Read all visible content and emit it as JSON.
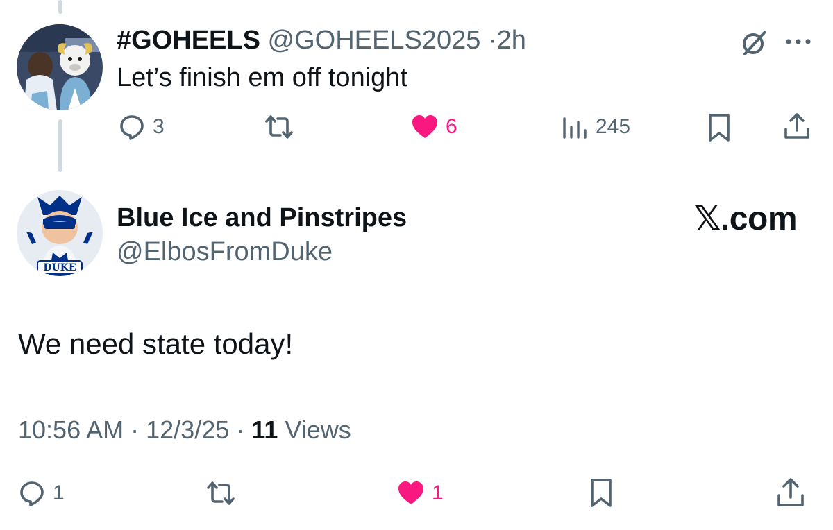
{
  "reply_tweet": {
    "display_name": "#GOHEELS",
    "handle": "@GOHEELS2025",
    "separator": "·",
    "time": "2h",
    "text": "Let’s finish em off tonight",
    "actions": {
      "replies": "3",
      "retweets": "",
      "likes": "6",
      "views": "245"
    },
    "avatar_icon": "unc-mascot-avatar",
    "grok_icon": "grok-icon",
    "more_icon": "more-options-icon"
  },
  "main_tweet": {
    "display_name": "Blue Ice and Pinstripes",
    "handle": "@ElbosFromDuke",
    "brand": "𝕏.com",
    "text": "We need state today!",
    "time": "10:56 AM",
    "date": "12/3/25",
    "separator": "·",
    "views_count": "11",
    "views_label": "Views",
    "actions": {
      "replies": "1",
      "retweets": "",
      "likes": "1"
    },
    "avatar_icon": "duke-mascot-avatar",
    "avatar_text": "DUKE"
  },
  "colors": {
    "text": "#0f1419",
    "secondary": "#536471",
    "like": "#f91880",
    "thread_line": "#cfd9de",
    "duke_blue": "#003087"
  }
}
